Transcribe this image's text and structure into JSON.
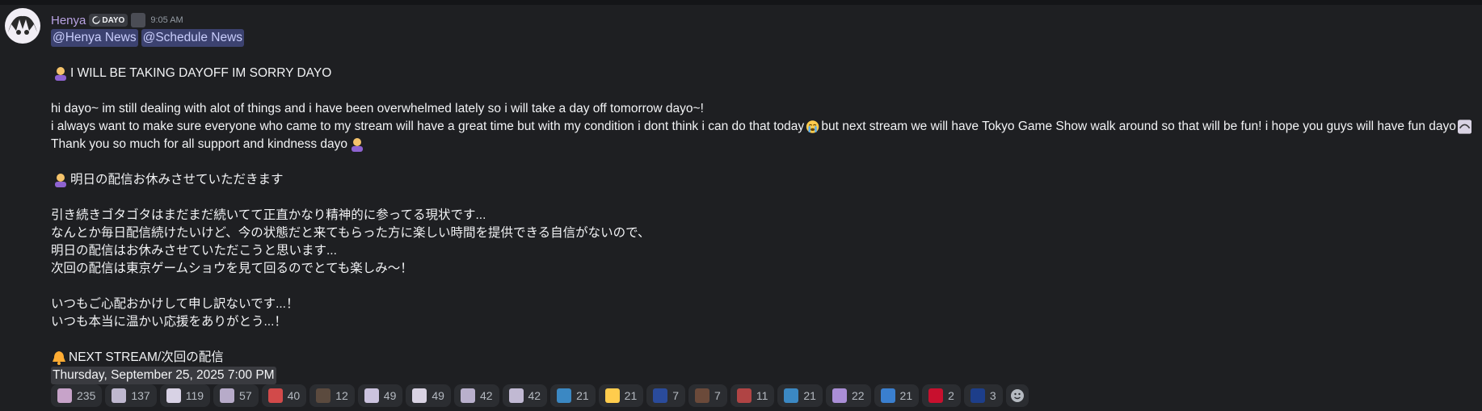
{
  "message": {
    "author": "Henya",
    "tag": "DAYO",
    "time": "9:05 AM",
    "mentions": [
      "@Henya News",
      "@Schedule News"
    ],
    "lines": [
      "I WILL BE TAKING DAYOFF IM SORRY DAYO",
      "hi dayo~ im still dealing with alot of things and i have been overwhelmed lately so i will take a day off tomorrow dayo~!",
      "i always want to make sure everyone who came to my stream will have a great time but with my condition i dont think i can do that today",
      "but next stream we will have Tokyo Game Show walk around so that will be fun! i hope you guys will have fun dayo",
      "Thank you so much for all support and kindness dayo",
      "明日の配信お休みさせていただきます",
      "引き続きゴタゴタはまだまだ続いてて正直かなり精神的に参ってる現状です...",
      "なんとか毎日配信続けたいけど、今の状態だと来てもらった方に楽しい時間を提供できる自信がないので、",
      "明日の配信はお休みさせていただこうと思います...",
      "次回の配信は東京ゲームショウを見て回るのでとても楽しみ〜！",
      "いつもご心配おかけして申し訳ないです...！",
      "いつも本当に温かい応援をありがとう...！",
      "NEXT STREAM/次回の配信"
    ],
    "schedule": "Thursday, September 25, 2025 7:00 PM"
  },
  "reactions": [
    {
      "icon": "custom-emoji",
      "color": "#c7a3c9",
      "count": "235"
    },
    {
      "icon": "custom-emoji",
      "color": "#bfb8cf",
      "count": "137"
    },
    {
      "icon": "custom-emoji",
      "color": "#d8d2e5",
      "count": "119"
    },
    {
      "icon": "custom-emoji",
      "color": "#b7abc9",
      "count": "57"
    },
    {
      "icon": "custom-emoji",
      "color": "#d24a4a",
      "count": "40"
    },
    {
      "icon": "custom-emoji",
      "color": "#5b4a3e",
      "count": "12"
    },
    {
      "icon": "custom-emoji",
      "color": "#cbc3de",
      "count": "49"
    },
    {
      "icon": "custom-emoji",
      "color": "#d9d3e3",
      "count": "49"
    },
    {
      "icon": "custom-emoji",
      "color": "#b9b0cc",
      "count": "42"
    },
    {
      "icon": "custom-emoji",
      "color": "#c1b9d3",
      "count": "42"
    },
    {
      "icon": "letter-o-emoji",
      "color": "#3b88c3",
      "count": "21"
    },
    {
      "icon": "thumbs-up-emoji",
      "color": "#ffcc4d",
      "count": "21"
    },
    {
      "icon": "australia-flag",
      "color": "#2a4b9b",
      "count": "7"
    },
    {
      "icon": "custom-emoji",
      "color": "#6b4a3a",
      "count": "7"
    },
    {
      "icon": "custom-emoji",
      "color": "#b04444",
      "count": "11"
    },
    {
      "icon": "letter-k-emoji",
      "color": "#3b88c3",
      "count": "21"
    },
    {
      "icon": "purple-heart-emoji",
      "color": "#aa8ed6",
      "count": "22"
    },
    {
      "icon": "custom-emoji",
      "color": "#3a7fcf",
      "count": "21"
    },
    {
      "icon": "wales-flag",
      "color": "#c8102e",
      "count": "2"
    },
    {
      "icon": "uk-flag",
      "color": "#1d3e8a",
      "count": "3"
    }
  ],
  "colors": {
    "background": "#1e1f22",
    "username": "#b9a3e3",
    "mention_bg": "#3c4270",
    "mention_text": "#c9cdfb",
    "reaction_bg": "#2b2d31"
  }
}
